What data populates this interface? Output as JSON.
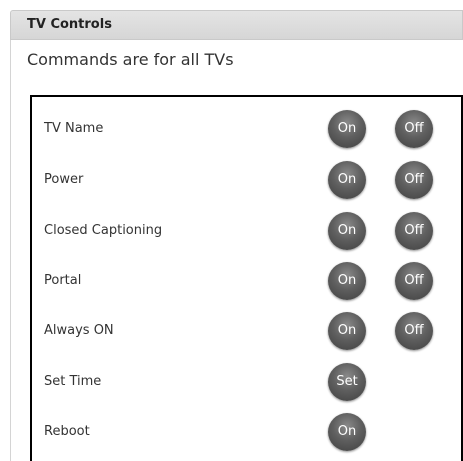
{
  "panel": {
    "title": "TV Controls",
    "subtitle": "Commands are for all TVs"
  },
  "rows": [
    {
      "label": "TV Name",
      "buttons": [
        "On",
        "Off"
      ]
    },
    {
      "label": "Power",
      "buttons": [
        "On",
        "Off"
      ]
    },
    {
      "label": "Closed Captioning",
      "buttons": [
        "On",
        "Off"
      ]
    },
    {
      "label": "Portal",
      "buttons": [
        "On",
        "Off"
      ]
    },
    {
      "label": "Always ON",
      "buttons": [
        "On",
        "Off"
      ]
    },
    {
      "label": "Set Time",
      "buttons": [
        "Set"
      ]
    },
    {
      "label": "Reboot",
      "buttons": [
        "On"
      ]
    }
  ]
}
